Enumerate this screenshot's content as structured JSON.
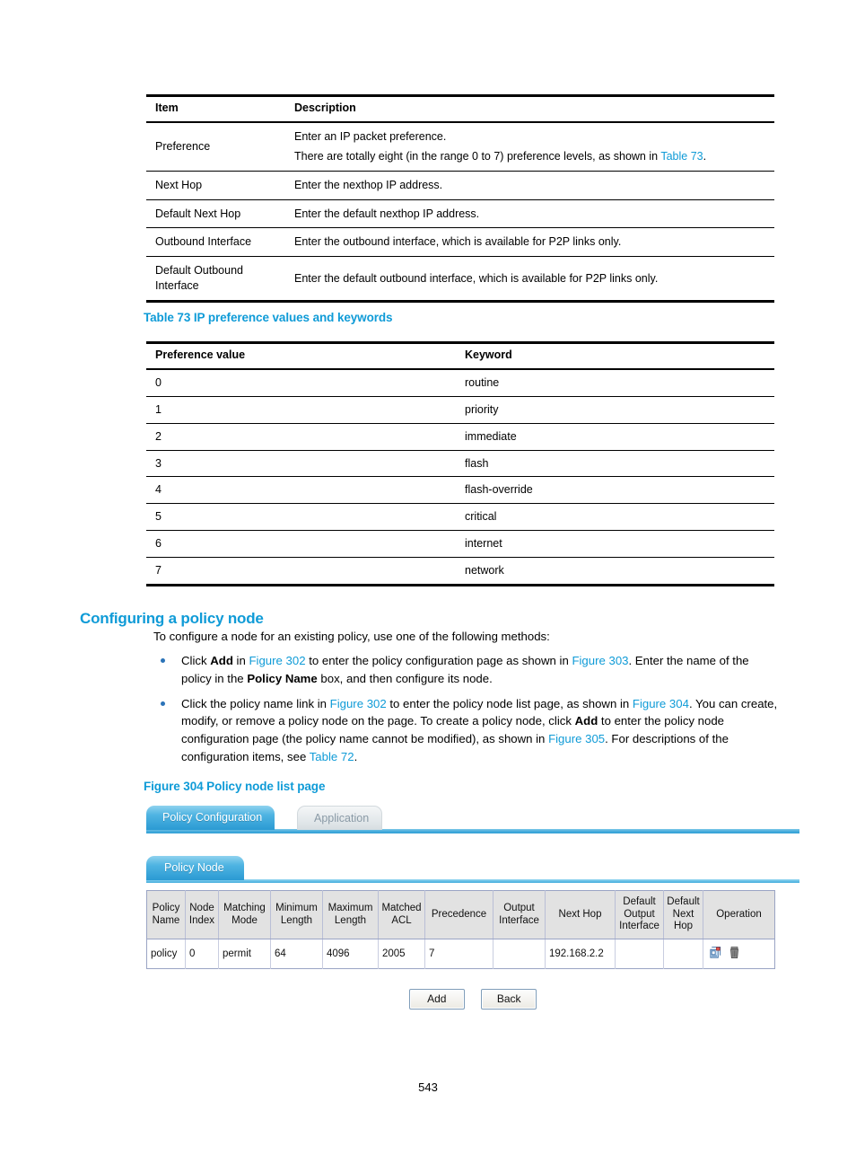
{
  "colors": {
    "link_blue": "#0f9bd7",
    "tab_active_blue": "#2a9ad3",
    "bullet_blue": "#2b73b8"
  },
  "table_72": {
    "headers": [
      "Item",
      "Description"
    ],
    "rows": [
      {
        "item": "Preference",
        "desc_line1": "Enter an IP packet preference.",
        "desc_line2_pre": "There are totally eight (in the range 0 to 7) preference levels, as shown in ",
        "desc_line2_link": "Table 73",
        "desc_line2_post": "."
      },
      {
        "item": "Next Hop",
        "desc": "Enter the nexthop IP address."
      },
      {
        "item": "Default Next Hop",
        "desc": "Enter the default nexthop IP address."
      },
      {
        "item": "Outbound Interface",
        "desc": "Enter the outbound interface, which is available for P2P links only."
      },
      {
        "item": "Default Outbound Interface",
        "desc": "Enter the default outbound interface, which is available for P2P links only."
      }
    ]
  },
  "table_73": {
    "caption": "Table 73 IP preference values and keywords",
    "headers": [
      "Preference value",
      "Keyword"
    ],
    "rows": [
      {
        "value": "0",
        "keyword": "routine"
      },
      {
        "value": "1",
        "keyword": "priority"
      },
      {
        "value": "2",
        "keyword": "immediate"
      },
      {
        "value": "3",
        "keyword": "flash"
      },
      {
        "value": "4",
        "keyword": "flash-override"
      },
      {
        "value": "5",
        "keyword": "critical"
      },
      {
        "value": "6",
        "keyword": "internet"
      },
      {
        "value": "7",
        "keyword": "network"
      }
    ]
  },
  "section": {
    "heading": "Configuring a policy node",
    "intro": "To configure a node for an existing policy, use one of the following methods:",
    "bullets": [
      {
        "p1": "Click ",
        "b1": "Add",
        "p2": " in ",
        "x1": "Figure 302",
        "p3": " to enter the policy configuration page as shown in ",
        "x2": "Figure 303",
        "p4": ". Enter the name of the policy in the ",
        "b2": "Policy Name",
        "p5": " box, and then configure its node."
      },
      {
        "p1": "Click the policy name link in ",
        "x1": "Figure 302",
        "p2": " to enter the policy node list page, as shown in ",
        "x2": "Figure 304",
        "p3": ". You can create, modify, or remove a policy node on the page. To create a policy node, click ",
        "b1": "Add",
        "p4": " to enter the policy node configuration page (the policy name cannot be modified), as shown in ",
        "x3": "Figure 305",
        "p5": ". For descriptions of the configuration items, see ",
        "x4": "Table 72",
        "p6": "."
      }
    ]
  },
  "figure_304": {
    "caption": "Figure 304 Policy node list page",
    "primary_tabs": [
      {
        "label": "Policy Configuration",
        "active": true
      },
      {
        "label": "Application",
        "active": false
      }
    ],
    "secondary_tabs": [
      {
        "label": "Policy Node",
        "active": true
      }
    ],
    "table": {
      "headers": [
        "Policy Name",
        "Node Index",
        "Matching Mode",
        "Minimum Length",
        "Maximum Length",
        "Matched ACL",
        "Precedence",
        "Output Interface",
        "Next Hop",
        "Default Output Interface",
        "Default Next Hop",
        "Operation"
      ],
      "rows": [
        {
          "policy_name": "policy",
          "node_index": "0",
          "matching_mode": "permit",
          "minimum_length": "64",
          "maximum_length": "4096",
          "matched_acl": "2005",
          "precedence": "7",
          "output_interface": "",
          "next_hop": "192.168.2.2",
          "default_output_interface": "",
          "default_next_hop": "",
          "operation_icons": [
            "edit-properties-icon",
            "delete-trash-icon"
          ]
        }
      ]
    },
    "buttons": [
      {
        "label": "Add"
      },
      {
        "label": "Back"
      }
    ]
  },
  "footer": {
    "page_number": "543"
  }
}
